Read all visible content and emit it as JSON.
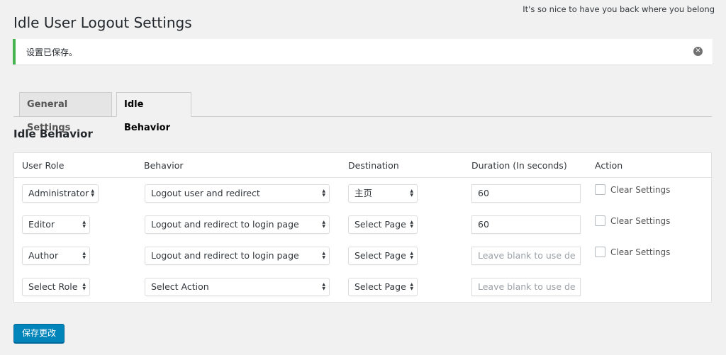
{
  "header": {
    "greeting": "It's so nice to have you back where you belong",
    "page_title": "Idle User Logout Settings"
  },
  "notice": {
    "message": "设置已保存。",
    "close_icon": "close-circle-icon"
  },
  "tabs": [
    {
      "label": "General Settings",
      "active": false
    },
    {
      "label": "Idle Behavior",
      "active": true
    }
  ],
  "section_title": "Idle Behavior",
  "table": {
    "headers": [
      "User Role",
      "Behavior",
      "Destination",
      "Duration (In seconds)",
      "Action"
    ],
    "rows": [
      {
        "role": "Administrator",
        "behavior": "Logout user and redirect",
        "destination": "主页",
        "duration_value": "60",
        "duration_placeholder": "",
        "action_label": "Clear Settings",
        "checked": false
      },
      {
        "role": "Editor",
        "behavior": "Logout and redirect to login page",
        "destination": "Select Page",
        "duration_value": "60",
        "duration_placeholder": "",
        "action_label": "Clear Settings",
        "checked": false
      },
      {
        "role": "Author",
        "behavior": "Logout and redirect to login page",
        "destination": "Select Page",
        "duration_value": "",
        "duration_placeholder": "Leave blank to use de",
        "action_label": "Clear Settings",
        "checked": false
      },
      {
        "role": "Select Role",
        "behavior": "Select Action",
        "destination": "Select Page",
        "duration_value": "",
        "duration_placeholder": "Leave blank to use de",
        "action_label": "",
        "checked": false
      }
    ]
  },
  "save_button": "保存更改",
  "colors": {
    "notice_success": "#46b450",
    "primary_button": "#0085ba",
    "background": "#f1f1f1"
  }
}
